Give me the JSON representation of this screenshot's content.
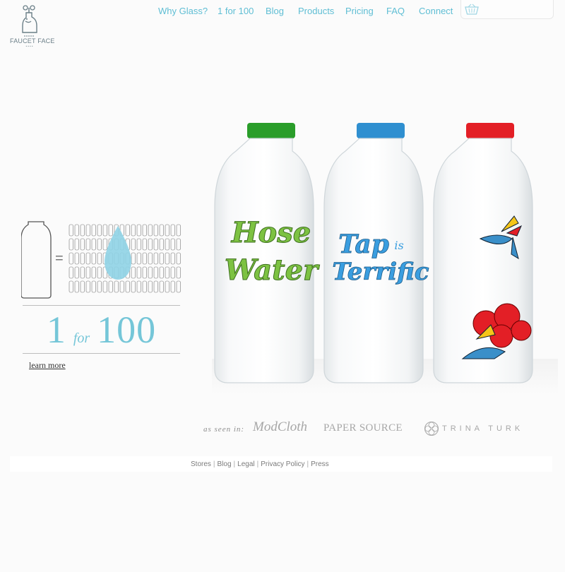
{
  "brand": {
    "name": "FAUCET FACE",
    "logo_icon": "faucet-face-logo"
  },
  "nav": {
    "items": [
      {
        "label": "Why Glass?"
      },
      {
        "label": "1 for 100"
      },
      {
        "label": "Blog"
      },
      {
        "label": "Products"
      },
      {
        "label": "Pricing"
      },
      {
        "label": "FAQ"
      },
      {
        "label": "Connect"
      }
    ],
    "cart_icon": "shopping-basket-icon"
  },
  "promo": {
    "equals": "=",
    "one": "1",
    "for": "for",
    "hundred": "100",
    "learn_more": "learn more",
    "drop_icon": "water-drop-icon"
  },
  "bottles": [
    {
      "cap_color": "#2a9d2a",
      "label_lines": [
        "Hose",
        "Water"
      ],
      "label_color": "#7dc242"
    },
    {
      "cap_color": "#2f8fd0",
      "label_lines": [
        "Tap",
        "is",
        "Terrific"
      ],
      "label_color": "#3a9ee0"
    },
    {
      "cap_color": "#e31f26",
      "label_lines": [],
      "label_color": "#e31f26"
    }
  ],
  "press": {
    "as_seen_in": "as seen in:",
    "logos": {
      "modcloth": "ModCloth",
      "papersource": "PAPER SOURCE",
      "trinaturk": "TRINA TURK"
    }
  },
  "footer": {
    "links": [
      "Stores",
      "Blog",
      "Legal",
      "Privacy Policy",
      "Press"
    ],
    "separator": "|"
  },
  "colors": {
    "accent": "#5fbed4",
    "drop": "#8fd3e6",
    "background": "#fbfbfb"
  }
}
